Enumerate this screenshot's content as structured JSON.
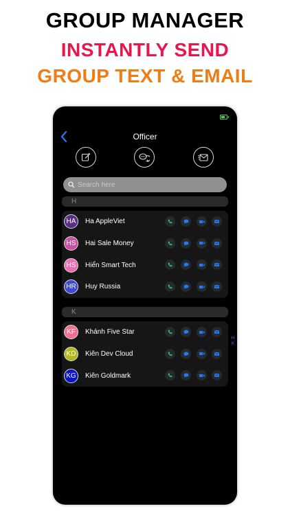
{
  "promo": {
    "line1": "GROUP MANAGER",
    "line2": "INSTANTLY SEND",
    "line3": "GROUP TEXT & EMAIL"
  },
  "nav": {
    "title": "Officer"
  },
  "search": {
    "placeholder": "Search here"
  },
  "sections": [
    {
      "letter": "H",
      "contacts": [
        {
          "initials": "HA",
          "name": "Ha AppleViet",
          "avatar_color": "#5b2d86"
        },
        {
          "initials": "HS",
          "name": "Hai Sale Money",
          "avatar_color": "#cc4fa2"
        },
        {
          "initials": "HS",
          "name": "Hiển Smart Tech",
          "avatar_color": "#f06cb5"
        },
        {
          "initials": "HR",
          "name": "Huy Russia",
          "avatar_color": "#3d4ad6"
        }
      ]
    },
    {
      "letter": "K",
      "contacts": [
        {
          "initials": "KF",
          "name": "Khánh Five Star",
          "avatar_color": "#f36f8f"
        },
        {
          "initials": "KD",
          "name": "Kiên Dev Cloud",
          "avatar_color": "#b3b81f"
        },
        {
          "initials": "KG",
          "name": "Kiên Goldmark",
          "avatar_color": "#0a15c8"
        }
      ]
    }
  ],
  "index_letters": [
    "H",
    "K"
  ],
  "colors": {
    "call": "#34c759",
    "message": "#1e7bf2",
    "video": "#1e7bf2",
    "email": "#1e7bf2",
    "accent_red": "#e9154f",
    "accent_orange": "#f07c15"
  }
}
